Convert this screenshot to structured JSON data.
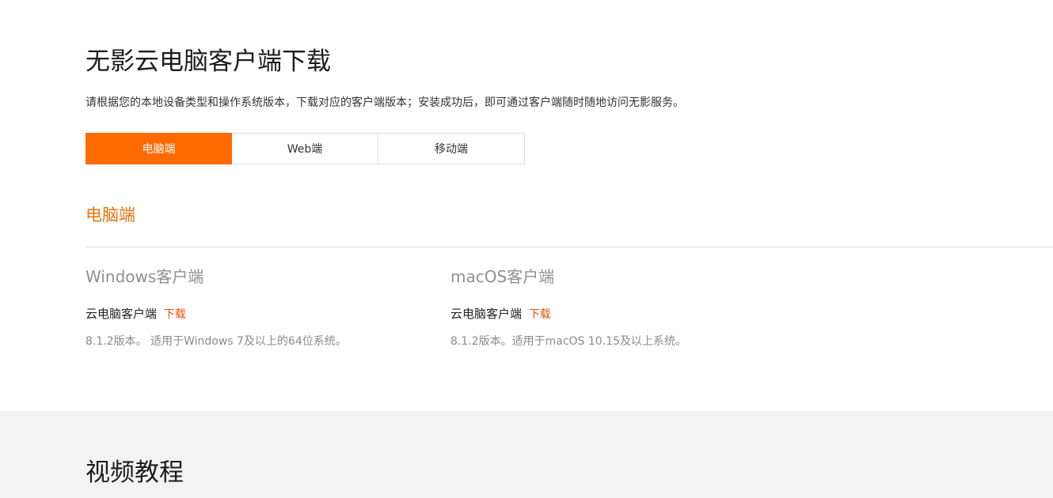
{
  "header": {
    "title": "无影云电脑客户端下载",
    "description": "请根据您的本地设备类型和操作系统版本，下载对应的客户端版本；安装成功后，即可通过客户端随时随地访问无影服务。"
  },
  "tabs": [
    {
      "label": "电脑端",
      "active": true
    },
    {
      "label": "Web端",
      "active": false
    },
    {
      "label": "移动端",
      "active": false
    }
  ],
  "section": {
    "heading": "电脑端"
  },
  "clients": {
    "windows": {
      "title": "Windows客户端",
      "name": "云电脑客户端",
      "download_label": "下载",
      "note": "8.1.2版本。 适用于Windows 7及以上的64位系统。"
    },
    "mac": {
      "title": "macOS客户端",
      "name": "云电脑客户端",
      "download_label": "下载",
      "note": "8.1.2版本。适用于macOS 10.15及以上系统。"
    }
  },
  "video": {
    "title": "视频教程"
  },
  "colors": {
    "accent": "#ff6a00",
    "heading_orange": "#e8730c",
    "link": "#e8520c",
    "video_bg": "#f3f3f3"
  }
}
